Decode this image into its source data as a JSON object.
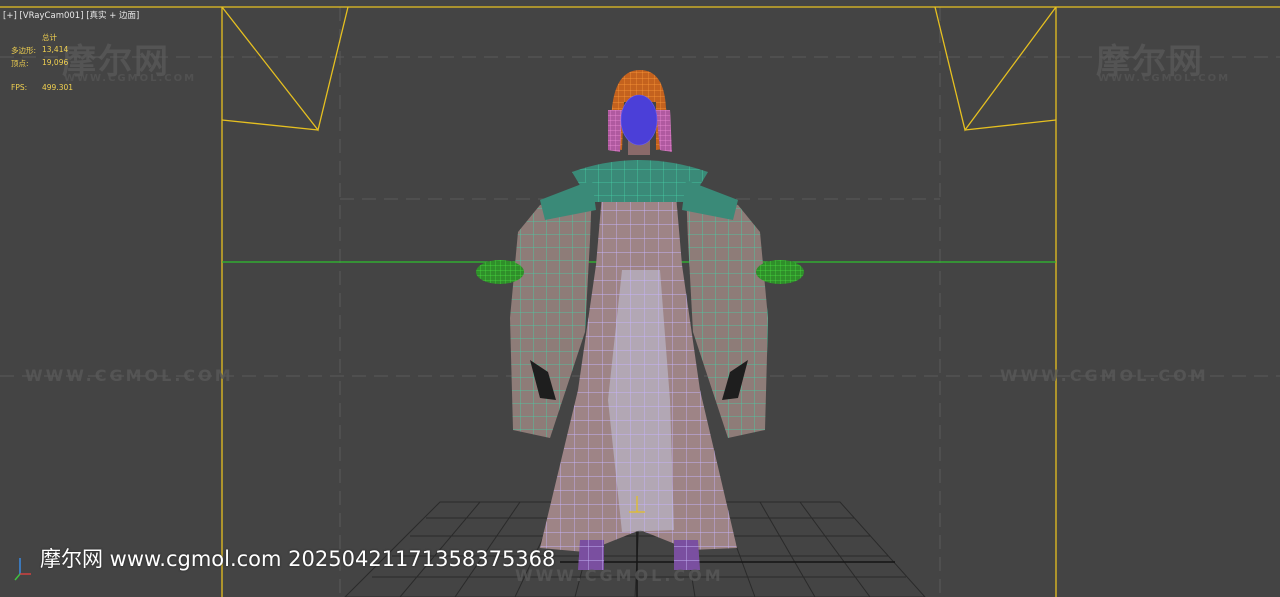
{
  "viewport": {
    "label": "[+] [VRayCam001] [真实 + 边面]"
  },
  "stats": {
    "header": "总计",
    "polys_label": "多边形:",
    "polys_value": "13,414",
    "verts_label": "顶点:",
    "verts_value": "19,096",
    "fps_label": "FPS:",
    "fps_value": "499.301"
  },
  "watermarks": {
    "brand_cn": "摩尔网",
    "brand_url": "WWW.CGMOL.COM",
    "bottom_text": "摩尔网 www.cgmol.com 20250421171358375368"
  },
  "colors": {
    "background": "#444444",
    "safe_frame": "#e6c020",
    "horizon_line": "#2fbf2f",
    "stats_text": "#f0d050",
    "dress_wire": "#b9a6f0",
    "sleeve_wire": "#3fc6a0",
    "hair": "#e0782a",
    "face": "#4b3fd8"
  }
}
